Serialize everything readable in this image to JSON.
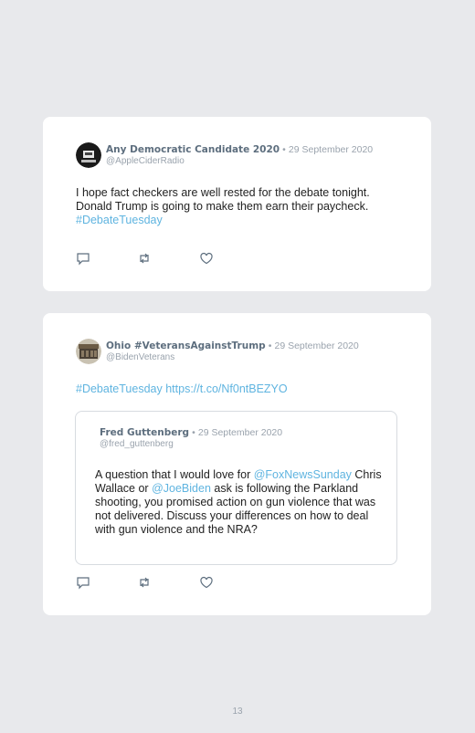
{
  "tweets": [
    {
      "name": "Any Democratic Candidate 2020",
      "separator": "•",
      "date": "29 September 2020",
      "handle": "@AppleCiderRadio",
      "text_1": "I hope fact checkers are well rested for the debate tonight. Donald Trump is going to make them earn their paycheck.",
      "hashtag": "#DebateTuesday"
    },
    {
      "name": "Ohio #VeteransAgainstTrump",
      "separator": "•",
      "date": "29 September 2020",
      "handle": "@BidenVeterans",
      "hashtag": "#DebateTuesday",
      "link": "https://t.co/Nf0ntBEZYO",
      "quoted": {
        "name": "Fred Guttenberg",
        "separator": "•",
        "date": "29 September 2020",
        "handle": "@fred_guttenberg",
        "text_1": "A question that I would love for",
        "mention_1": "@FoxNewsSunday",
        "text_2": "Chris Wallace or",
        "mention_2": "@JoeBiden",
        "text_3": "ask is following the Parkland shooting, you promised action on gun violence that was not delivered. Discuss your differences on how to deal with gun violence and the NRA?"
      }
    }
  ],
  "icons": [
    "reply-icon",
    "retweet-icon",
    "like-icon"
  ],
  "colors": {
    "background": "#e8e9ec",
    "card": "#ffffff",
    "link": "#5fb4e0",
    "name": "#5d6e7e",
    "meta": "#9aa3ad"
  },
  "page_number": "13"
}
